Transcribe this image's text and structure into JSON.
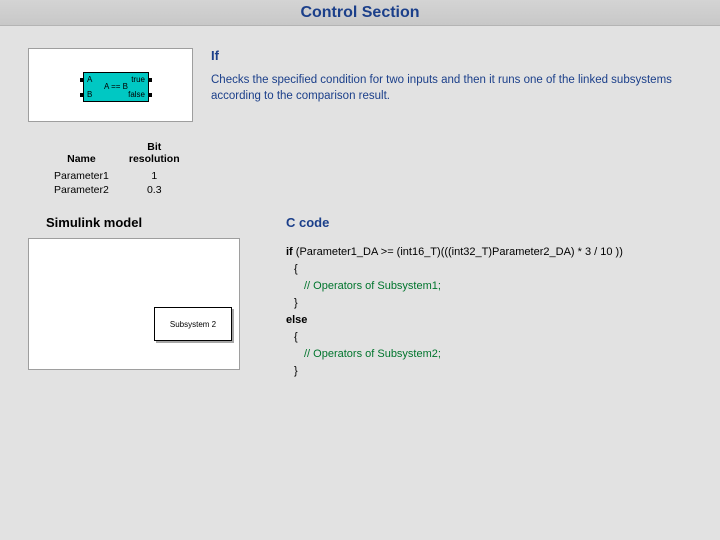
{
  "header": {
    "title": "Control Section"
  },
  "thumbnail": {
    "labels": {
      "a": "A",
      "b": "B",
      "true": "true",
      "false": "false",
      "mid": "A == B"
    }
  },
  "description": {
    "name": "If",
    "text": "Checks the specified condition for two inputs and then it runs one of the linked subsystems according to the comparison result."
  },
  "params": {
    "headers": {
      "name": "Name",
      "bit": "Bit\nresolution"
    },
    "rows": [
      {
        "name": "Parameter1",
        "bit": "1"
      },
      {
        "name": "Parameter2",
        "bit": "0.3"
      }
    ]
  },
  "simulink": {
    "title": "Simulink model",
    "sub2_label": "Subsystem 2"
  },
  "ccode": {
    "title": "C code",
    "line_if_pre": "if",
    "line_if_cond": " (Parameter1_DA >= (int16_T)(((int32_T)Parameter2_DA) * 3 / 10 ))",
    "brace_open": " {",
    "comment1": "// Operators of Subsystem1;",
    "brace_close": " }",
    "line_else": "else",
    "brace_open2": " {",
    "comment2": "// Operators of Subsystem2;",
    "brace_close2": " }"
  }
}
